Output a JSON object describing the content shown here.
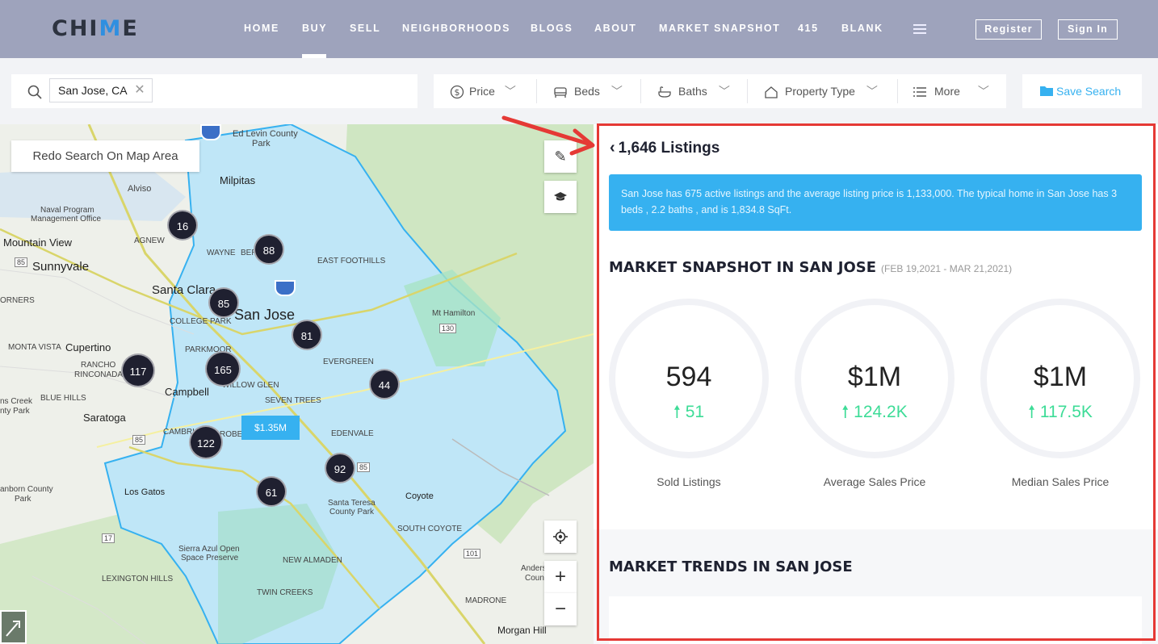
{
  "header": {
    "logo_pre": "CHI",
    "logo_v": "M",
    "logo_post": "E",
    "nav": [
      "HOME",
      "BUY",
      "SELL",
      "NEIGHBORHOODS",
      "BLOGS",
      "ABOUT",
      "MARKET SNAPSHOT",
      "415",
      "BLANK"
    ],
    "active_nav": "BUY",
    "register": "Register",
    "signin": "Sign In"
  },
  "search": {
    "location_chip": "San Jose, CA",
    "clear_icon": "close-icon"
  },
  "filters": {
    "price": "Price",
    "beds": "Beds",
    "baths": "Baths",
    "property_type": "Property Type",
    "more": "More",
    "save_search": "Save Search"
  },
  "map": {
    "redo": "Redo Search On Map Area",
    "clusters": [
      "16",
      "88",
      "85",
      "81",
      "117",
      "165",
      "44",
      "122",
      "92",
      "61"
    ],
    "price_pin": "$1.35M",
    "labels": {
      "ed_levin": "Ed Levin County",
      "park": "Park",
      "milpitas": "Milpitas",
      "alviso": "Alviso",
      "naval": "Naval Program",
      "mgmt": "Management Office",
      "agnew": "AGNEW",
      "mountain_view": "Mountain View",
      "sunnyvale": "Sunnyvale",
      "wayne": "WAYNE",
      "berryessa": "BER",
      "east_foothills": "EAST FOOTHILLS",
      "santa_clara": "Santa Clara",
      "san_jose": "San Jose",
      "college_park": "COLLEGE PARK",
      "corners": "ORNERS",
      "mt_hamilton": "Mt Hamilton",
      "monta_vista": "MONTA VISTA",
      "cupertino": "Cupertino",
      "parkmoor": "PARKMOOR",
      "evergreen": "EVERGREEN",
      "rancho": "RANCHO",
      "rinconada": "RINCONADA",
      "willow_glen": "WILLOW GLEN",
      "campbell": "Campbell",
      "blue_hills": "BLUE HILLS",
      "seven_trees": "SEVEN TREES",
      "saratoga": "Saratoga",
      "edenvale": "EDENVALE",
      "cambrian": "CAMBRI",
      "robertsville": "ROBE",
      "los_gatos": "Los Gatos",
      "coyote": "Coyote",
      "santa_teresa": "Santa Teresa",
      "county_park": "County Park",
      "south_coyote": "SOUTH COYOTE",
      "sierra_azul": "Sierra Azul Open",
      "space_preserve": "Space Preserve",
      "new_almaden": "NEW ALMADEN",
      "lexington": "LEXINGTON HILLS",
      "twin_creeks": "TWIN CREEKS",
      "madrone": "MADRONE",
      "morgan_hill": "Morgan Hill",
      "sanborn": "anborn County",
      "sanborn_park": "Park",
      "ns_creek": "ns Creek",
      "nty_park": "nty Park",
      "anders": "Anders",
      "coun": "Coun",
      "hwy_85a": "85",
      "hwy_85b": "85",
      "hwy_85c": "85",
      "hwy_17": "17",
      "hwy_101": "101",
      "hwy_130": "130"
    }
  },
  "panel": {
    "listings": "1,646 Listings",
    "info": "San Jose has 675 active listings and the average listing price is 1,133,000. The typical home in San Jose has 3 beds , 2.2 baths , and is 1,834.8 SqFt.",
    "snapshot_title": "MARKET SNAPSHOT IN SAN JOSE",
    "snapshot_range": "(FEB 19,2021 - MAR 21,2021)",
    "stats": [
      {
        "value": "594",
        "change": "51",
        "label": "Sold Listings"
      },
      {
        "value": "$1M",
        "change": "124.2K",
        "label": "Average Sales Price"
      },
      {
        "value": "$1M",
        "change": "117.5K",
        "label": "Median Sales Price"
      }
    ],
    "trends_title": "MARKET TRENDS IN SAN JOSE"
  },
  "colors": {
    "header_bg": "#9ea3bc",
    "accent_blue": "#36b1f0",
    "change_green": "#3ddc97",
    "highlight_red": "#e53935",
    "cluster_dark": "#1f2030"
  }
}
